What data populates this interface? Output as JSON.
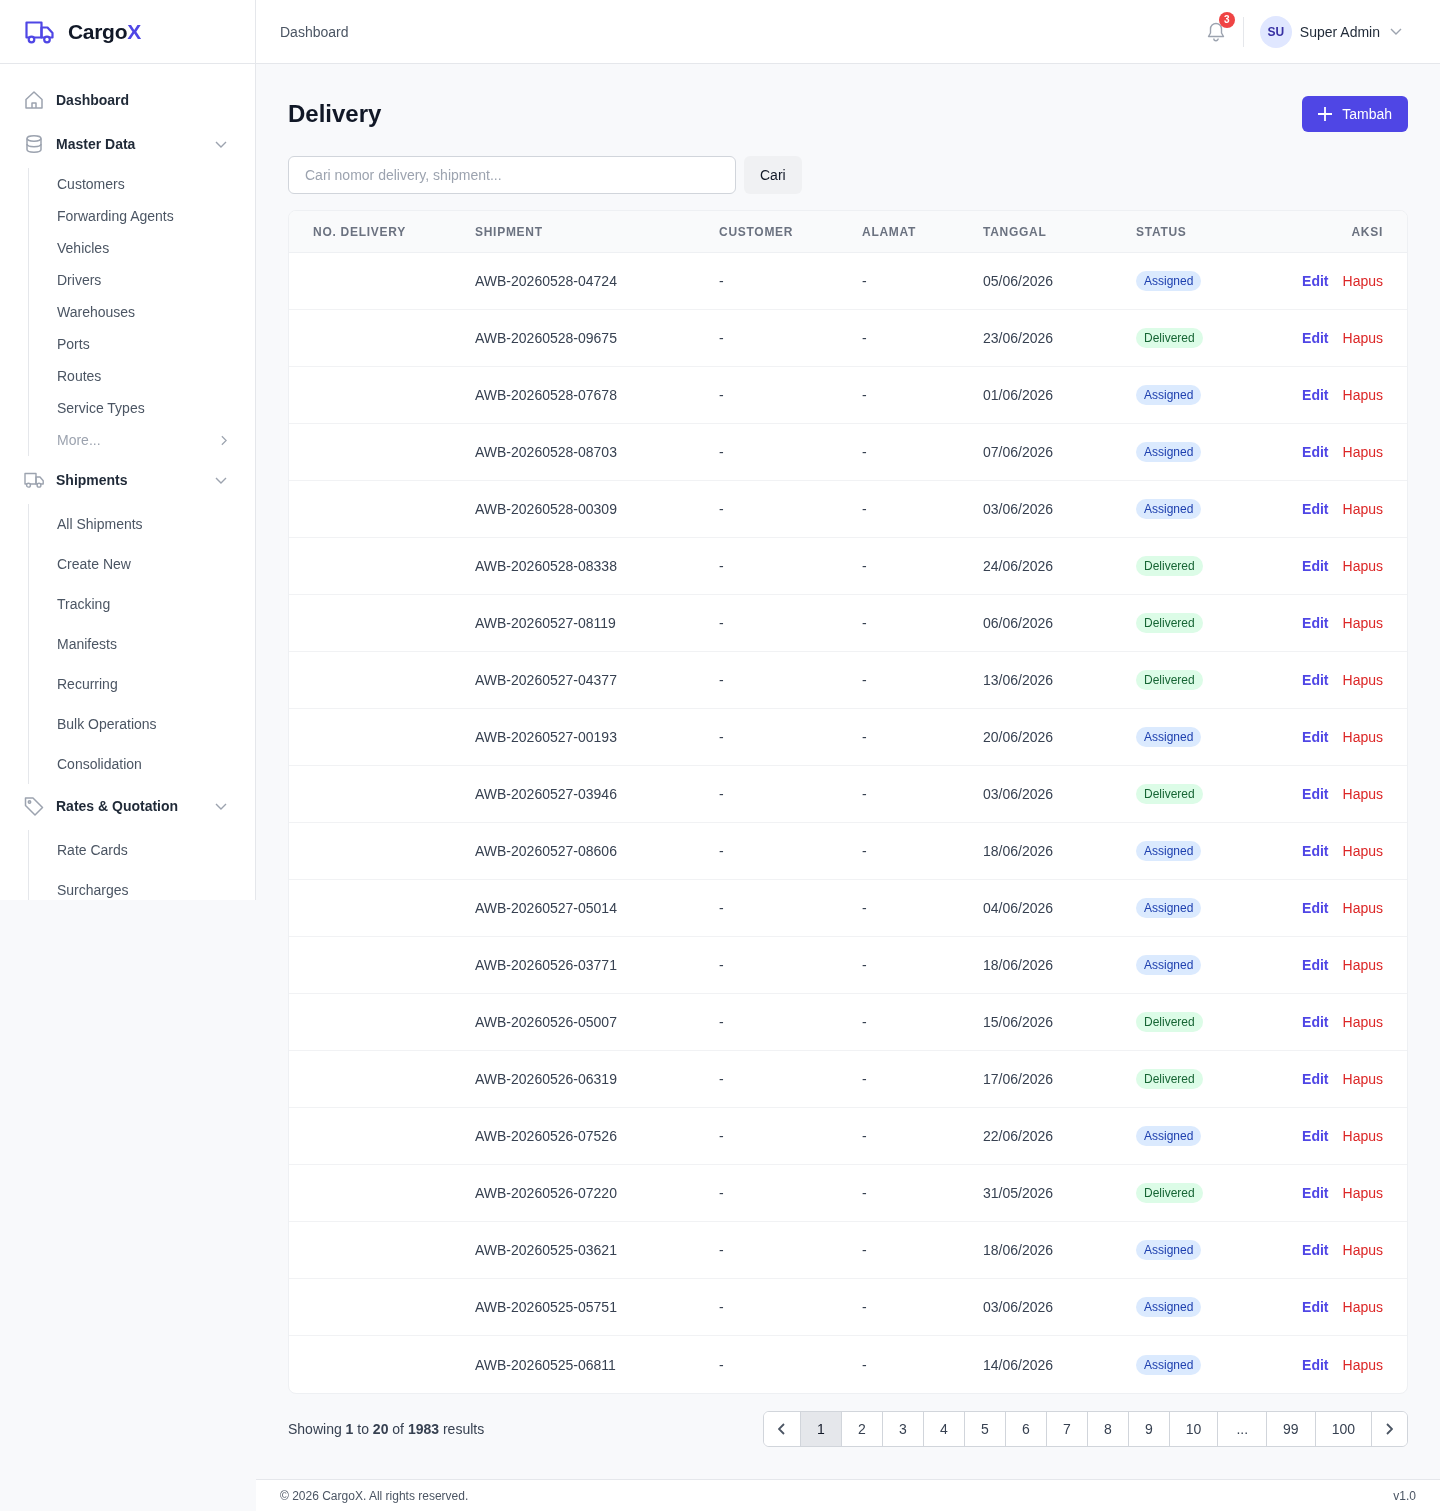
{
  "sidebar": {
    "logo": {
      "text": "Cargo",
      "accent": "X"
    },
    "nav": [
      {
        "label": "Dashboard",
        "kind": "link"
      },
      {
        "label": "Master Data",
        "kind": "group",
        "expanded": true,
        "compact": true,
        "children": [
          {
            "label": "Customers",
            "kind": "link"
          },
          {
            "label": "Forwarding Agents",
            "kind": "link"
          },
          {
            "label": "Vehicles",
            "kind": "link"
          },
          {
            "label": "Drivers",
            "kind": "link"
          },
          {
            "label": "Warehouses",
            "kind": "link"
          },
          {
            "label": "Ports",
            "kind": "link"
          },
          {
            "label": "Routes",
            "kind": "link"
          },
          {
            "label": "Service Types",
            "kind": "link"
          },
          {
            "label": "More...",
            "kind": "more"
          }
        ]
      },
      {
        "label": "Shipments",
        "kind": "group",
        "expanded": true,
        "compact": false,
        "children": [
          {
            "label": "All Shipments",
            "kind": "link"
          },
          {
            "label": "Create New",
            "kind": "link"
          },
          {
            "label": "Tracking",
            "kind": "link"
          },
          {
            "label": "Manifests",
            "kind": "link"
          },
          {
            "label": "Recurring",
            "kind": "link"
          },
          {
            "label": "Bulk Operations",
            "kind": "link"
          },
          {
            "label": "Consolidation",
            "kind": "link"
          }
        ]
      },
      {
        "label": "Rates & Quotation",
        "kind": "group",
        "expanded": true,
        "compact": false,
        "children": [
          {
            "label": "Rate Cards",
            "kind": "link"
          },
          {
            "label": "Surcharges",
            "kind": "link"
          }
        ]
      }
    ]
  },
  "header": {
    "breadcrumb": "Dashboard",
    "notifications": {
      "count": "3"
    },
    "user": {
      "initials": "SU",
      "name": "Super Admin"
    }
  },
  "page": {
    "title": "Delivery",
    "add_button": "Tambah",
    "search": {
      "placeholder": "Cari nomor delivery, shipment...",
      "button": "Cari"
    }
  },
  "table": {
    "columns": [
      "NO. DELIVERY",
      "SHIPMENT",
      "CUSTOMER",
      "ALAMAT",
      "TANGGAL",
      "STATUS",
      "AKSI"
    ],
    "rows": [
      {
        "shipment": "AWB-20260528-04724",
        "customer": "-",
        "alamat": "-",
        "tanggal": "05/06/2026",
        "status": {
          "label": "Assigned",
          "kind": "assigned"
        },
        "edit": "Edit",
        "delete": "Hapus"
      },
      {
        "shipment": "AWB-20260528-09675",
        "customer": "-",
        "alamat": "-",
        "tanggal": "23/06/2026",
        "status": {
          "label": "Delivered",
          "kind": "delivered"
        },
        "edit": "Edit",
        "delete": "Hapus"
      },
      {
        "shipment": "AWB-20260528-07678",
        "customer": "-",
        "alamat": "-",
        "tanggal": "01/06/2026",
        "status": {
          "label": "Assigned",
          "kind": "assigned"
        },
        "edit": "Edit",
        "delete": "Hapus"
      },
      {
        "shipment": "AWB-20260528-08703",
        "customer": "-",
        "alamat": "-",
        "tanggal": "07/06/2026",
        "status": {
          "label": "Assigned",
          "kind": "assigned"
        },
        "edit": "Edit",
        "delete": "Hapus"
      },
      {
        "shipment": "AWB-20260528-00309",
        "customer": "-",
        "alamat": "-",
        "tanggal": "03/06/2026",
        "status": {
          "label": "Assigned",
          "kind": "assigned"
        },
        "edit": "Edit",
        "delete": "Hapus"
      },
      {
        "shipment": "AWB-20260528-08338",
        "customer": "-",
        "alamat": "-",
        "tanggal": "24/06/2026",
        "status": {
          "label": "Delivered",
          "kind": "delivered"
        },
        "edit": "Edit",
        "delete": "Hapus"
      },
      {
        "shipment": "AWB-20260527-08119",
        "customer": "-",
        "alamat": "-",
        "tanggal": "06/06/2026",
        "status": {
          "label": "Delivered",
          "kind": "delivered"
        },
        "edit": "Edit",
        "delete": "Hapus"
      },
      {
        "shipment": "AWB-20260527-04377",
        "customer": "-",
        "alamat": "-",
        "tanggal": "13/06/2026",
        "status": {
          "label": "Delivered",
          "kind": "delivered"
        },
        "edit": "Edit",
        "delete": "Hapus"
      },
      {
        "shipment": "AWB-20260527-00193",
        "customer": "-",
        "alamat": "-",
        "tanggal": "20/06/2026",
        "status": {
          "label": "Assigned",
          "kind": "assigned"
        },
        "edit": "Edit",
        "delete": "Hapus"
      },
      {
        "shipment": "AWB-20260527-03946",
        "customer": "-",
        "alamat": "-",
        "tanggal": "03/06/2026",
        "status": {
          "label": "Delivered",
          "kind": "delivered"
        },
        "edit": "Edit",
        "delete": "Hapus"
      },
      {
        "shipment": "AWB-20260527-08606",
        "customer": "-",
        "alamat": "-",
        "tanggal": "18/06/2026",
        "status": {
          "label": "Assigned",
          "kind": "assigned"
        },
        "edit": "Edit",
        "delete": "Hapus"
      },
      {
        "shipment": "AWB-20260527-05014",
        "customer": "-",
        "alamat": "-",
        "tanggal": "04/06/2026",
        "status": {
          "label": "Assigned",
          "kind": "assigned"
        },
        "edit": "Edit",
        "delete": "Hapus"
      },
      {
        "shipment": "AWB-20260526-03771",
        "customer": "-",
        "alamat": "-",
        "tanggal": "18/06/2026",
        "status": {
          "label": "Assigned",
          "kind": "assigned"
        },
        "edit": "Edit",
        "delete": "Hapus"
      },
      {
        "shipment": "AWB-20260526-05007",
        "customer": "-",
        "alamat": "-",
        "tanggal": "15/06/2026",
        "status": {
          "label": "Delivered",
          "kind": "delivered"
        },
        "edit": "Edit",
        "delete": "Hapus"
      },
      {
        "shipment": "AWB-20260526-06319",
        "customer": "-",
        "alamat": "-",
        "tanggal": "17/06/2026",
        "status": {
          "label": "Delivered",
          "kind": "delivered"
        },
        "edit": "Edit",
        "delete": "Hapus"
      },
      {
        "shipment": "AWB-20260526-07526",
        "customer": "-",
        "alamat": "-",
        "tanggal": "22/06/2026",
        "status": {
          "label": "Assigned",
          "kind": "assigned"
        },
        "edit": "Edit",
        "delete": "Hapus"
      },
      {
        "shipment": "AWB-20260526-07220",
        "customer": "-",
        "alamat": "-",
        "tanggal": "31/05/2026",
        "status": {
          "label": "Delivered",
          "kind": "delivered"
        },
        "edit": "Edit",
        "delete": "Hapus"
      },
      {
        "shipment": "AWB-20260525-03621",
        "customer": "-",
        "alamat": "-",
        "tanggal": "18/06/2026",
        "status": {
          "label": "Assigned",
          "kind": "assigned"
        },
        "edit": "Edit",
        "delete": "Hapus"
      },
      {
        "shipment": "AWB-20260525-05751",
        "customer": "-",
        "alamat": "-",
        "tanggal": "03/06/2026",
        "status": {
          "label": "Assigned",
          "kind": "assigned"
        },
        "edit": "Edit",
        "delete": "Hapus"
      },
      {
        "shipment": "AWB-20260525-06811",
        "customer": "-",
        "alamat": "-",
        "tanggal": "14/06/2026",
        "status": {
          "label": "Assigned",
          "kind": "assigned"
        },
        "edit": "Edit",
        "delete": "Hapus"
      }
    ]
  },
  "pagination": {
    "summary": "Showing **1** to **20** of **1983** results",
    "pages": [
      {
        "label": "1",
        "kind": "page",
        "selected": true
      },
      {
        "label": "2",
        "kind": "page",
        "selected": false
      },
      {
        "label": "3",
        "kind": "page",
        "selected": false
      },
      {
        "label": "4",
        "kind": "page",
        "selected": false
      },
      {
        "label": "5",
        "kind": "page",
        "selected": false
      },
      {
        "label": "6",
        "kind": "page",
        "selected": false
      },
      {
        "label": "7",
        "kind": "page",
        "selected": false
      },
      {
        "label": "8",
        "kind": "page",
        "selected": false
      },
      {
        "label": "9",
        "kind": "page",
        "selected": false
      },
      {
        "label": "10",
        "kind": "page",
        "selected": false
      },
      {
        "label": "...",
        "kind": "gap",
        "selected": false
      },
      {
        "label": "99",
        "kind": "page",
        "selected": false
      },
      {
        "label": "100",
        "kind": "page",
        "selected": false
      }
    ]
  },
  "footer": {
    "copyright": "© 2026 CargoX. All rights reserved.",
    "version": "v1.0"
  }
}
